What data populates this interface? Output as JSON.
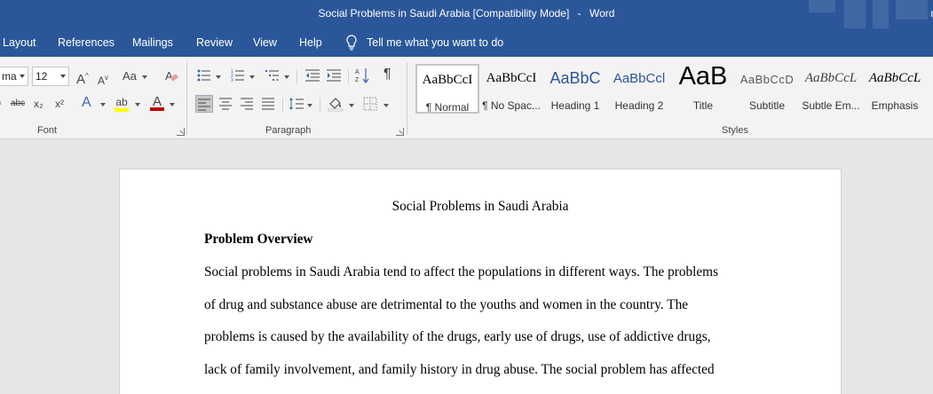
{
  "titlebar": {
    "doc_title": "Social Problems in Saudi Arabia [Compatibility Mode]",
    "separator": "-",
    "app_name": "Word",
    "right_letter": "n"
  },
  "tabs": [
    {
      "label": "Layout"
    },
    {
      "label": "References"
    },
    {
      "label": "Mailings"
    },
    {
      "label": "Review"
    },
    {
      "label": "View"
    },
    {
      "label": "Help"
    }
  ],
  "tell_me": "Tell me what you want to do",
  "font": {
    "name": "ma",
    "size": "12",
    "group_label": "Font",
    "grow_glyph": "A",
    "shrink_glyph": "A",
    "case_glyph": "Aa",
    "strike_glyph": "abc",
    "subscript_glyph": "x₂",
    "superscript_glyph": "x²",
    "effects_glyph": "A",
    "highlight_glyph": "ab",
    "color_glyph": "A"
  },
  "paragraph": {
    "group_label": "Paragraph",
    "pilcrow": "¶"
  },
  "styles": {
    "group_label": "Styles",
    "items": [
      {
        "sample": "AaBbCcI",
        "name": "¶ Normal"
      },
      {
        "sample": "AaBbCcI",
        "name": "¶ No Spac..."
      },
      {
        "sample": "AaBbC",
        "name": "Heading 1"
      },
      {
        "sample": "AaBbCcl",
        "name": "Heading 2"
      },
      {
        "sample": "AaB",
        "name": "Title"
      },
      {
        "sample": "AaBbCcD",
        "name": "Subtitle"
      },
      {
        "sample": "AaBbCcL",
        "name": "Subtle Em..."
      },
      {
        "sample": "AaBbCcL",
        "name": "Emphasis"
      }
    ]
  },
  "colors": {
    "accent": "#2b579a",
    "highlight": "#ffff00",
    "font_color": "#c00000"
  },
  "document": {
    "title": "Social Problems in Saudi Arabia",
    "heading": "Problem Overview",
    "lines": [
      "Social problems in Saudi Arabia tend to affect the populations in different ways. The problems",
      "of drug and substance abuse are detrimental to the youths and women in the country. The",
      "problems is caused by the availability of the drugs, early use of drugs, use of addictive drugs,",
      "lack of family involvement, and family history in drug abuse. The social problem has affected"
    ]
  }
}
